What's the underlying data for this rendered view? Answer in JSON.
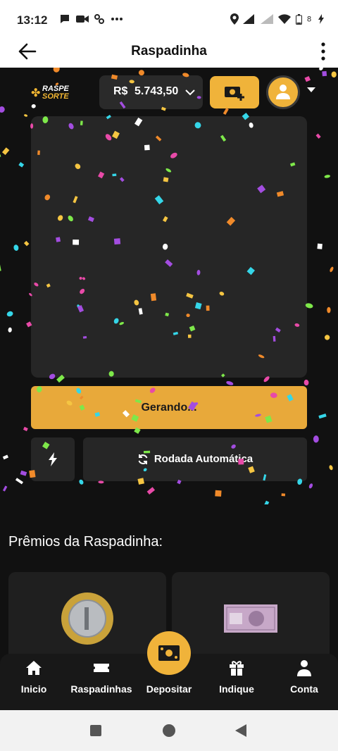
{
  "status_bar": {
    "time": "13:12",
    "battery": "8"
  },
  "app_bar": {
    "title": "Raspadinha"
  },
  "header": {
    "logo_line1": "RASPE",
    "logo_line2": "SORTE",
    "currency": "R$",
    "balance": "5.743,50"
  },
  "game": {
    "generating_label": "Gerando...",
    "auto_label": "Rodada Automática"
  },
  "prizes": {
    "title": "Prêmios da Raspadinha:"
  },
  "bottom_nav": {
    "items": [
      {
        "label": "Inicio",
        "icon": "home-icon"
      },
      {
        "label": "Raspadinhas",
        "icon": "ticket-icon"
      },
      {
        "label": "Depositar",
        "icon": "cash-icon"
      },
      {
        "label": "Indique",
        "icon": "gift-icon"
      },
      {
        "label": "Conta",
        "icon": "user-icon"
      }
    ]
  },
  "colors": {
    "accent": "#f0b33a",
    "background": "#111111",
    "card": "#262626"
  }
}
